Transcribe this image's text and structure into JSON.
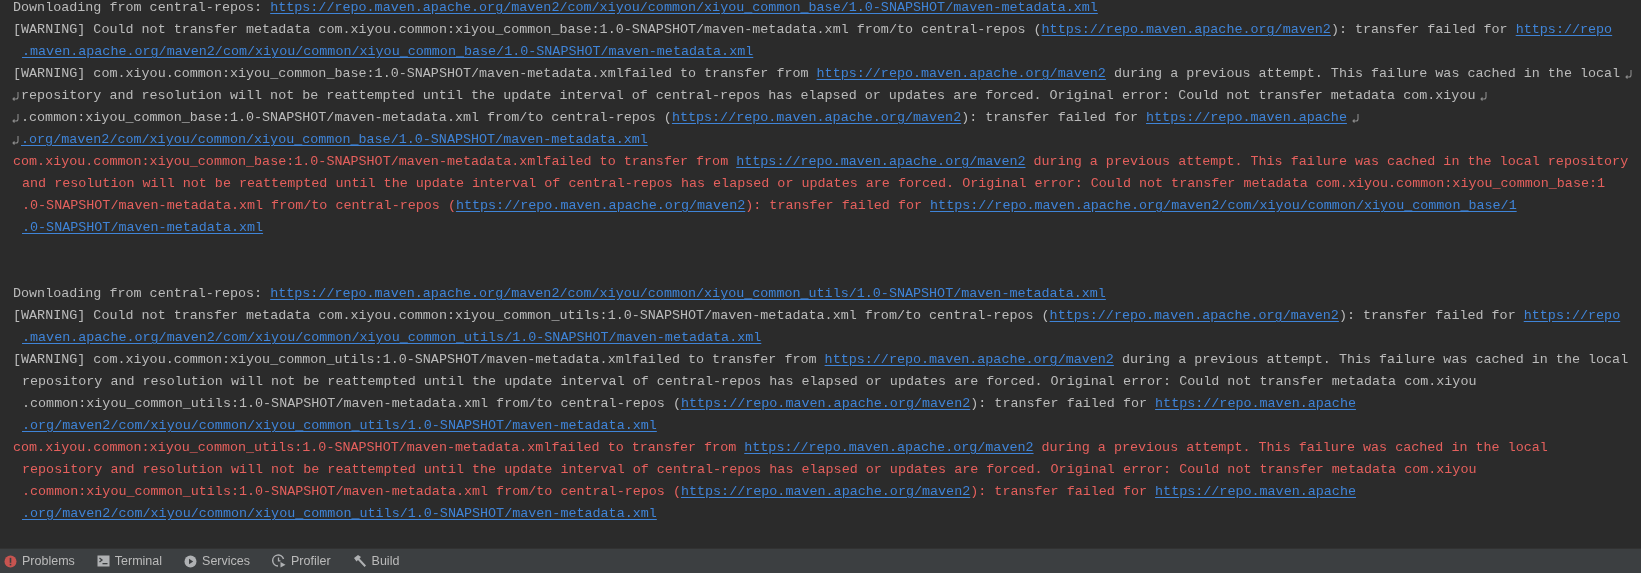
{
  "console": {
    "lines": [
      {
        "kind": "plain",
        "continuation": false,
        "wrap_start": false,
        "wrap_end": false,
        "segments": [
          {
            "text": "Downloading from central-repos: ",
            "link": false
          },
          {
            "text": "https://repo.maven.apache.org/maven2/com/xiyou/common/xiyou_common_base/1.0-SNAPSHOT/maven-metadata.xml",
            "link": true
          }
        ]
      },
      {
        "kind": "plain",
        "continuation": false,
        "wrap_start": false,
        "wrap_end": false,
        "segments": [
          {
            "text": "[WARNING] Could not transfer metadata com.xiyou.common:xiyou_common_base:1.0-SNAPSHOT/maven-metadata.xml from/to central-repos (",
            "link": false
          },
          {
            "text": "https://repo.maven.apache.org/maven2",
            "link": true
          },
          {
            "text": "): transfer failed for ",
            "link": false
          },
          {
            "text": "https://repo",
            "link": true
          }
        ]
      },
      {
        "kind": "plain",
        "continuation": true,
        "wrap_start": false,
        "wrap_end": false,
        "segments": [
          {
            "text": ".maven.apache.org/maven2/com/xiyou/common/xiyou_common_base/1.0-SNAPSHOT/maven-metadata.xml",
            "link": true
          }
        ]
      },
      {
        "kind": "plain",
        "continuation": false,
        "wrap_start": false,
        "wrap_end": true,
        "segments": [
          {
            "text": "[WARNING] com.xiyou.common:xiyou_common_base:1.0-SNAPSHOT/maven-metadata.xmlfailed to transfer from ",
            "link": false
          },
          {
            "text": "https://repo.maven.apache.org/maven2",
            "link": true
          },
          {
            "text": " during a previous attempt. This failure was cached in the local",
            "link": false
          }
        ]
      },
      {
        "kind": "plain",
        "continuation": false,
        "wrap_start": true,
        "wrap_end": true,
        "segments": [
          {
            "text": "repository and resolution will not be reattempted until the update interval of central-repos has elapsed or updates are forced. Original error: Could not transfer metadata com.xiyou",
            "link": false
          }
        ]
      },
      {
        "kind": "plain",
        "continuation": false,
        "wrap_start": true,
        "wrap_end": true,
        "segments": [
          {
            "text": ".common:xiyou_common_base:1.0-SNAPSHOT/maven-metadata.xml from/to central-repos (",
            "link": false
          },
          {
            "text": "https://repo.maven.apache.org/maven2",
            "link": true
          },
          {
            "text": "): transfer failed for ",
            "link": false
          },
          {
            "text": "https://repo.maven.apache",
            "link": true
          }
        ]
      },
      {
        "kind": "plain",
        "continuation": false,
        "wrap_start": true,
        "wrap_end": false,
        "segments": [
          {
            "text": ".org/maven2/com/xiyou/common/xiyou_common_base/1.0-SNAPSHOT/maven-metadata.xml",
            "link": true
          }
        ]
      },
      {
        "kind": "error",
        "continuation": false,
        "wrap_start": false,
        "wrap_end": false,
        "segments": [
          {
            "text": "com.xiyou.common:xiyou_common_base:1.0-SNAPSHOT/maven-metadata.xmlfailed to transfer from ",
            "link": false
          },
          {
            "text": "https://repo.maven.apache.org/maven2",
            "link": true
          },
          {
            "text": " during a previous attempt. This failure was cached in the local repository",
            "link": false
          }
        ]
      },
      {
        "kind": "error",
        "continuation": true,
        "wrap_start": false,
        "wrap_end": false,
        "segments": [
          {
            "text": "and resolution will not be reattempted until the update interval of central-repos has elapsed or updates are forced. Original error: Could not transfer metadata com.xiyou.common:xiyou_common_base:1",
            "link": false
          }
        ]
      },
      {
        "kind": "error",
        "continuation": true,
        "wrap_start": false,
        "wrap_end": false,
        "segments": [
          {
            "text": ".0-SNAPSHOT/maven-metadata.xml from/to central-repos (",
            "link": false
          },
          {
            "text": "https://repo.maven.apache.org/maven2",
            "link": true
          },
          {
            "text": "): transfer failed for ",
            "link": false
          },
          {
            "text": "https://repo.maven.apache.org/maven2/com/xiyou/common/xiyou_common_base/1",
            "link": true
          }
        ]
      },
      {
        "kind": "error",
        "continuation": true,
        "wrap_start": false,
        "wrap_end": false,
        "segments": [
          {
            "text": ".0-SNAPSHOT/maven-metadata.xml",
            "link": true
          }
        ]
      },
      {
        "kind": "blank"
      },
      {
        "kind": "blank"
      },
      {
        "kind": "plain",
        "continuation": false,
        "wrap_start": false,
        "wrap_end": false,
        "segments": [
          {
            "text": "Downloading from central-repos: ",
            "link": false
          },
          {
            "text": "https://repo.maven.apache.org/maven2/com/xiyou/common/xiyou_common_utils/1.0-SNAPSHOT/maven-metadata.xml",
            "link": true
          }
        ]
      },
      {
        "kind": "plain",
        "continuation": false,
        "wrap_start": false,
        "wrap_end": false,
        "segments": [
          {
            "text": "[WARNING] Could not transfer metadata com.xiyou.common:xiyou_common_utils:1.0-SNAPSHOT/maven-metadata.xml from/to central-repos (",
            "link": false
          },
          {
            "text": "https://repo.maven.apache.org/maven2",
            "link": true
          },
          {
            "text": "): transfer failed for ",
            "link": false
          },
          {
            "text": "https://repo",
            "link": true
          }
        ]
      },
      {
        "kind": "plain",
        "continuation": true,
        "wrap_start": false,
        "wrap_end": false,
        "segments": [
          {
            "text": ".maven.apache.org/maven2/com/xiyou/common/xiyou_common_utils/1.0-SNAPSHOT/maven-metadata.xml",
            "link": true
          }
        ]
      },
      {
        "kind": "plain",
        "continuation": false,
        "wrap_start": false,
        "wrap_end": false,
        "segments": [
          {
            "text": "[WARNING] com.xiyou.common:xiyou_common_utils:1.0-SNAPSHOT/maven-metadata.xmlfailed to transfer from ",
            "link": false
          },
          {
            "text": "https://repo.maven.apache.org/maven2",
            "link": true
          },
          {
            "text": " during a previous attempt. This failure was cached in the local",
            "link": false
          }
        ]
      },
      {
        "kind": "plain",
        "continuation": true,
        "wrap_start": false,
        "wrap_end": false,
        "segments": [
          {
            "text": "repository and resolution will not be reattempted until the update interval of central-repos has elapsed or updates are forced. Original error: Could not transfer metadata com.xiyou",
            "link": false
          }
        ]
      },
      {
        "kind": "plain",
        "continuation": true,
        "wrap_start": false,
        "wrap_end": false,
        "segments": [
          {
            "text": ".common:xiyou_common_utils:1.0-SNAPSHOT/maven-metadata.xml from/to central-repos (",
            "link": false
          },
          {
            "text": "https://repo.maven.apache.org/maven2",
            "link": true
          },
          {
            "text": "): transfer failed for ",
            "link": false
          },
          {
            "text": "https://repo.maven.apache",
            "link": true
          }
        ]
      },
      {
        "kind": "plain",
        "continuation": true,
        "wrap_start": false,
        "wrap_end": false,
        "segments": [
          {
            "text": ".org/maven2/com/xiyou/common/xiyou_common_utils/1.0-SNAPSHOT/maven-metadata.xml",
            "link": true
          }
        ]
      },
      {
        "kind": "error",
        "continuation": false,
        "wrap_start": false,
        "wrap_end": false,
        "segments": [
          {
            "text": "com.xiyou.common:xiyou_common_utils:1.0-SNAPSHOT/maven-metadata.xmlfailed to transfer from ",
            "link": false
          },
          {
            "text": "https://repo.maven.apache.org/maven2",
            "link": true
          },
          {
            "text": " during a previous attempt. This failure was cached in the local",
            "link": false
          }
        ]
      },
      {
        "kind": "error",
        "continuation": true,
        "wrap_start": false,
        "wrap_end": false,
        "segments": [
          {
            "text": "repository and resolution will not be reattempted until the update interval of central-repos has elapsed or updates are forced. Original error: Could not transfer metadata com.xiyou",
            "link": false
          }
        ]
      },
      {
        "kind": "error",
        "continuation": true,
        "wrap_start": false,
        "wrap_end": false,
        "segments": [
          {
            "text": ".common:xiyou_common_utils:1.0-SNAPSHOT/maven-metadata.xml from/to central-repos (",
            "link": false
          },
          {
            "text": "https://repo.maven.apache.org/maven2",
            "link": true
          },
          {
            "text": "): transfer failed for ",
            "link": false
          },
          {
            "text": "https://repo.maven.apache",
            "link": true
          }
        ]
      },
      {
        "kind": "error",
        "continuation": true,
        "wrap_start": false,
        "wrap_end": false,
        "segments": [
          {
            "text": ".org/maven2/com/xiyou/common/xiyou_common_utils/1.0-SNAPSHOT/maven-metadata.xml",
            "link": true
          }
        ]
      }
    ]
  },
  "tool_tabs": [
    {
      "kind": "problems",
      "label": "Problems"
    },
    {
      "kind": "terminal",
      "label": "Terminal"
    },
    {
      "kind": "services",
      "label": "Services"
    },
    {
      "kind": "profiler",
      "label": "Profiler"
    },
    {
      "kind": "build",
      "label": "Build"
    }
  ]
}
